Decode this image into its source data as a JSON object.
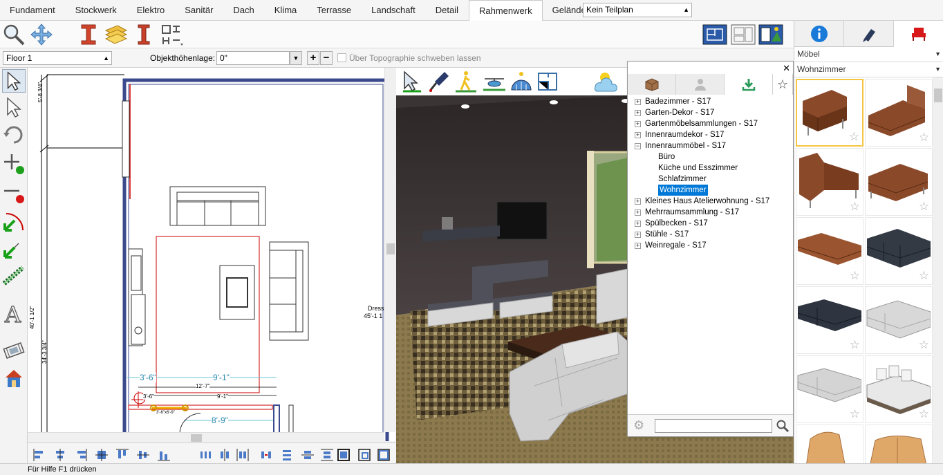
{
  "tabs": [
    "Fundament",
    "Stockwerk",
    "Elektro",
    "Sanitär",
    "Dach",
    "Klima",
    "Terrasse",
    "Landschaft",
    "Detail",
    "Rahmenwerk",
    "Gelände"
  ],
  "active_tab": "Rahmenwerk",
  "subplan_select": "Kein Teilplan",
  "floor_select": "Floor 1",
  "height_label": "Objekthöhenlage:",
  "height_value": "0\"",
  "topo_label": "Über Topographie schweben lassen",
  "plan": {
    "dims": {
      "d1": "5'-8 3/4\"",
      "d2": "40'-1 1/2\"",
      "d3": "34'-3 3/4\"",
      "d4": "3'-6\"",
      "d5": "9'-1\"",
      "d6": "12'-7\"",
      "d7": "9'-1\"",
      "d8": "3'-6\"",
      "d9": "8'-9\"",
      "d10": "3'-6\"x6'-9\"",
      "dress": "Dress",
      "dress_dim": "45'-1 1"
    }
  },
  "library": {
    "tree": [
      {
        "label": "Badezimmer - S17",
        "expand": "+"
      },
      {
        "label": "Garten-Dekor - S17",
        "expand": "+"
      },
      {
        "label": "Gartenmöbelsammlungen - S17",
        "expand": "+"
      },
      {
        "label": "Innenraumdekor - S17",
        "expand": "+"
      },
      {
        "label": "Innenraummöbel - S17",
        "expand": "−"
      },
      {
        "label": "Büro",
        "child": true
      },
      {
        "label": "Küche und Esszimmer",
        "child": true
      },
      {
        "label": "Schlafzimmer",
        "child": true
      },
      {
        "label": "Wohnzimmer",
        "child": true,
        "selected": true
      },
      {
        "label": "Kleines Haus Atelierwohnung - S17",
        "expand": "+"
      },
      {
        "label": "Mehrraumsammlung - S17",
        "expand": "+"
      },
      {
        "label": "Spülbecken - S17",
        "expand": "+"
      },
      {
        "label": "Stühle - S17",
        "expand": "+"
      },
      {
        "label": "Weinregale - S17",
        "expand": "+"
      }
    ]
  },
  "right_panel": {
    "category": "Möbel",
    "subcategory": "Wohnzimmer"
  },
  "status": "Für Hilfe F1 drücken",
  "colors": {
    "accent": "#0078d7",
    "wall": "#3b4a8c",
    "sofa_brown": "#8a4a2a",
    "sofa_dark": "#333a44",
    "sofa_white": "#d8d8d8"
  }
}
